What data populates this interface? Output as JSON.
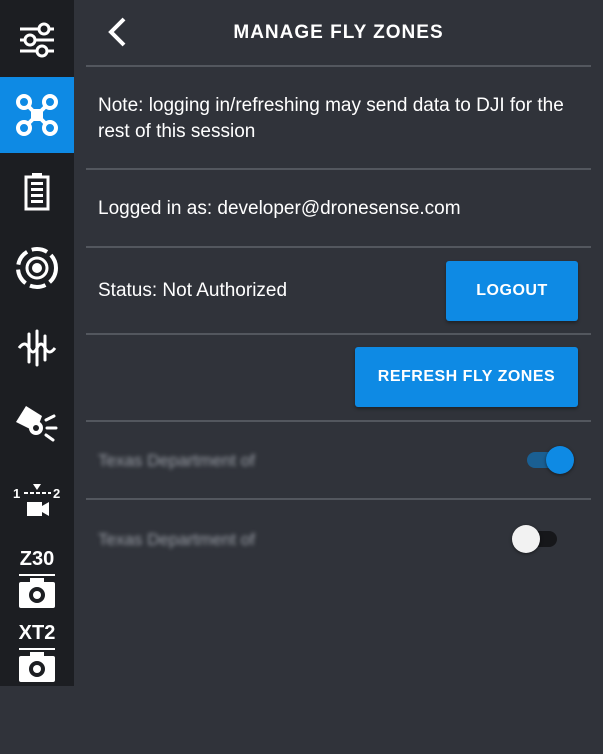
{
  "header": {
    "title": "MANAGE FLY ZONES",
    "back_icon": "chevron-left-icon"
  },
  "sidebar": {
    "active_color": "#0e8ae4",
    "items": [
      {
        "icon": "sliders-icon",
        "active": false
      },
      {
        "icon": "drone-icon",
        "active": true
      },
      {
        "icon": "battery-icon",
        "active": false
      },
      {
        "icon": "camera-lens-icon",
        "active": false
      },
      {
        "icon": "signal-wave-icon",
        "active": false
      },
      {
        "icon": "spotlight-icon",
        "active": false
      },
      {
        "icon": "camera-switch-icon",
        "label_left": "1",
        "label_right": "2",
        "active": false
      },
      {
        "icon": "camera-icon",
        "label": "Z30",
        "active": false
      },
      {
        "icon": "camera-icon",
        "label": "XT2",
        "active": false
      }
    ]
  },
  "note": {
    "text": "Note: logging in/refreshing may send data to DJI for the rest of this session"
  },
  "account": {
    "logged_in_text": "Logged in as: developer@dronesense.com"
  },
  "status": {
    "text": "Status: Not Authorized",
    "logout_label": "LOGOUT"
  },
  "refresh": {
    "label": "REFRESH FLY ZONES"
  },
  "zones": [
    {
      "name": "Texas Department of",
      "enabled": true
    },
    {
      "name": "Texas Department of",
      "enabled": false
    }
  ]
}
